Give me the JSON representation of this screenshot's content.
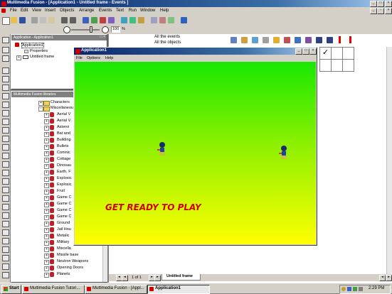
{
  "window": {
    "title": "Multimedia Fusion - [Application1 - Untitled frame - Events ]"
  },
  "menu": [
    "File",
    "Edit",
    "View",
    "Insert",
    "Objects",
    "Arrange",
    "Events",
    "Text",
    "Run",
    "Window",
    "Help"
  ],
  "toolbar": {
    "zoom_value": "100",
    "zoom_unit": "%"
  },
  "workspace": {
    "title": "Application - Application1",
    "items": [
      "Application1",
      "Properties",
      "Untitled frame"
    ]
  },
  "libraries": {
    "title": "Multimedia Fusion libraries",
    "folders": [
      "Characters",
      "Miscellaneous"
    ],
    "items": [
      "Aerial V",
      "Aerial V",
      "Asteroi",
      "Bat and",
      "Building",
      "Bullets",
      "Comnic",
      "Cottage",
      "Dinosau",
      "Earth, F",
      "Explosic",
      "Explosic",
      "Fruit",
      "Game C",
      "Game C",
      "Game C",
      "Game C",
      "Ground",
      "Jail Hou",
      "Metalic",
      "Military",
      "Miscella",
      "Missile base",
      "Neutron Weapons",
      "Opening Doors",
      "Planets"
    ]
  },
  "events": {
    "line1": "All the events",
    "line2": "All the objects"
  },
  "app_window": {
    "title": "Application1",
    "menu": [
      "File",
      "Options",
      "Help"
    ],
    "game_text": "GET READY TO PLAY"
  },
  "bottom_bar": {
    "page": "1 of 1",
    "tab": "Untitled frame"
  },
  "taskbar": {
    "start": "Start",
    "tasks": [
      "Multimedia Fusion Tutori...",
      "Multimedia Fusion - [Appl...",
      "Application1"
    ],
    "clock": "2:29 PM"
  },
  "colors": {
    "title_active": "#0a246a",
    "game_top": "#18e800",
    "game_bottom": "#ffff00",
    "game_text": "#d00000"
  }
}
